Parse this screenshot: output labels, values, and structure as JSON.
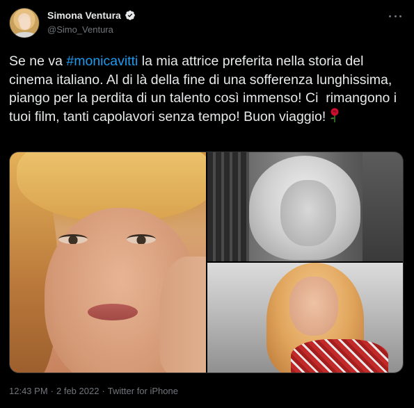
{
  "author": {
    "display_name": "Simona Ventura",
    "handle": "@Simo_Ventura",
    "verified": true
  },
  "tweet": {
    "text_before": "Se ne va ",
    "hashtag": "#monicavitti",
    "text_after": " la mia attrice preferita nella storia del cinema italiano. Al di là della fine di una sofferenza lunghissima, piango per la perdita di un talento così immenso! Ci  rimangono i tuoi film, tanti capolavori senza tempo! Buon viaggio!",
    "emoji": "rose-icon"
  },
  "media": {
    "count": 3
  },
  "meta": {
    "time": "12:43 PM",
    "separator1": "·",
    "date": "2 feb 2022",
    "separator2": "·",
    "source": "Twitter for iPhone"
  },
  "colors": {
    "background": "#000000",
    "text": "#e7e9ea",
    "secondary": "#71767b",
    "accent": "#1d9bf0"
  }
}
